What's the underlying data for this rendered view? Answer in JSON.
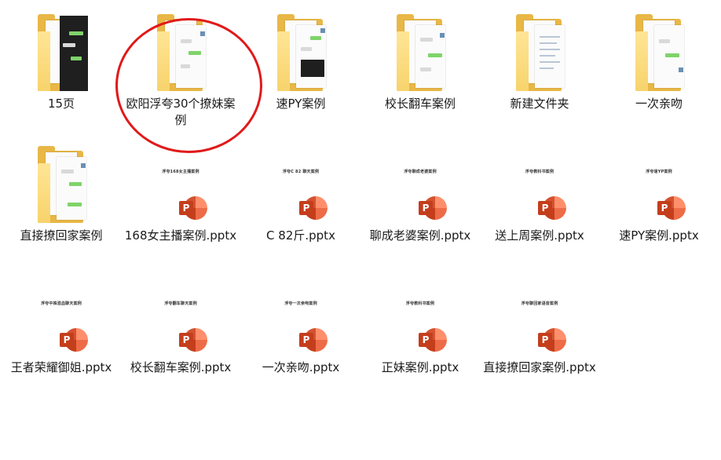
{
  "folders": [
    {
      "label": "15页"
    },
    {
      "label": "欧阳浮夸30个撩妹案例"
    },
    {
      "label": "速PY案例"
    },
    {
      "label": "校长翻车案例"
    },
    {
      "label": "新建文件夹"
    },
    {
      "label": "一次亲吻"
    },
    {
      "label": "直接撩回家案例"
    }
  ],
  "files": [
    {
      "label": "168女主播案例.pptx",
      "thumb_title": "浮夸168女主播案例"
    },
    {
      "label": "C 82斤.pptx",
      "thumb_title": "浮夸C 82 聊天案例"
    },
    {
      "label": "聊成老婆案例.pptx",
      "thumb_title": "浮夸聊成老婆案例"
    },
    {
      "label": "送上周案例.pptx",
      "thumb_title": "浮夸教科书案例"
    },
    {
      "label": "速PY案例.pptx",
      "thumb_title": "浮夸速YP案例"
    },
    {
      "label": "王者荣耀御姐.pptx",
      "thumb_title": "浮夸中株混血聊天案例"
    },
    {
      "label": "校长翻车案例.pptx",
      "thumb_title": "浮夸翻车聊天案例"
    },
    {
      "label": "一次亲吻.pptx",
      "thumb_title": "浮夸一次亲吻案例"
    },
    {
      "label": "正妹案例.pptx",
      "thumb_title": "浮夸教科书案例"
    },
    {
      "label": "直接撩回家案例.pptx",
      "thumb_title": "浮夸聊回家语音案例"
    }
  ],
  "ppt_letter": "P",
  "colors": {
    "annotation": "#e01a1a",
    "folder": "#f6cf63",
    "ppt": "#c43e1c"
  }
}
